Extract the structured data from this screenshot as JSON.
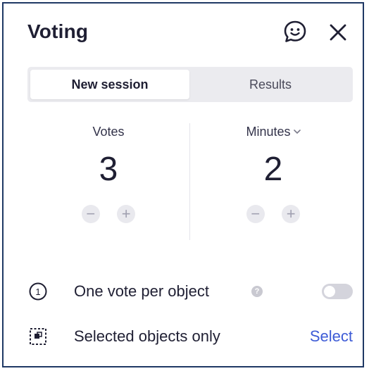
{
  "header": {
    "title": "Voting",
    "chat_icon": "chat-smile-icon",
    "close_icon": "close-icon"
  },
  "tabs": [
    {
      "label": "New session",
      "active": true
    },
    {
      "label": "Results",
      "active": false
    }
  ],
  "votes": {
    "label": "Votes",
    "value": "3",
    "decrement": "−",
    "increment": "+"
  },
  "minutes": {
    "label": "Minutes",
    "chevron": "⌄",
    "value": "2",
    "decrement": "−",
    "increment": "+"
  },
  "options": {
    "one_vote": {
      "label": "One vote per object",
      "icon_text": "1",
      "help": "?",
      "toggle_on": false
    },
    "selected_only": {
      "label": "Selected objects only",
      "action": "Select"
    }
  },
  "colors": {
    "accent": "#3d5bd6",
    "panel_border": "#1f3864",
    "toggle_off": "#d4d4dc"
  }
}
